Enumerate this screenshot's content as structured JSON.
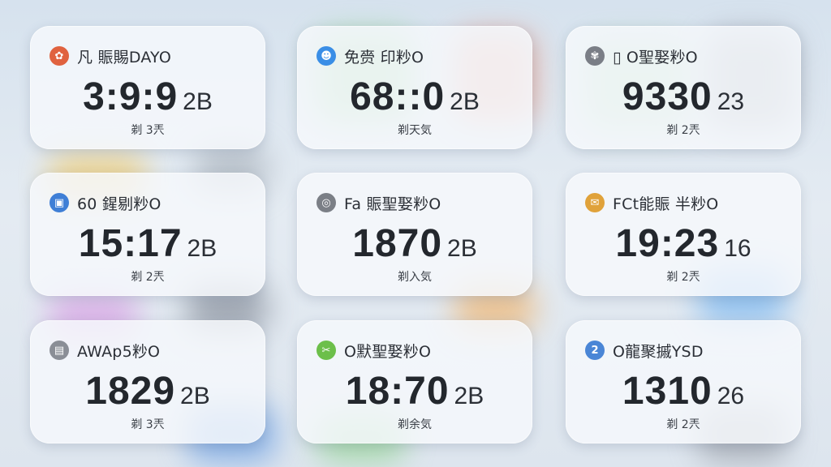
{
  "colors": {
    "background": "#dfe6ee",
    "card": "#f6f8fb",
    "text": "#23272d"
  },
  "cards": [
    {
      "title": "凡 賑賜DAYO",
      "time": "3:9:9",
      "unit": "2B",
      "sub": "剃 3兲",
      "icon": "gear-icon",
      "icon_color": "#e0623f",
      "icon_glyph": "✿"
    },
    {
      "title": "免赍 印粆O",
      "time": "68::0",
      "unit": "2B",
      "sub": "剃天気",
      "icon": "person-icon",
      "icon_color": "#3a8ee6",
      "icon_glyph": "☻"
    },
    {
      "title": "▯ O聖娶粆O",
      "time": "9330",
      "unit": "23",
      "sub": "剃 2兲",
      "icon": "flower-icon",
      "icon_color": "#7a7e86",
      "icon_glyph": "✾"
    },
    {
      "title": "60 鍟剔粆O",
      "time": "15:17",
      "unit": "2B",
      "sub": "剃 2兲",
      "icon": "card-icon",
      "icon_color": "#3f7fd6",
      "icon_glyph": "▣"
    },
    {
      "title": "Fa 賑聖娶粆O",
      "time": "1870",
      "unit": "2B",
      "sub": "剃入気",
      "icon": "compass-icon",
      "icon_color": "#7b7f86",
      "icon_glyph": "◎"
    },
    {
      "title": "FCt能賑 半粆O",
      "time": "19:23",
      "unit": "16",
      "sub": "剃 2兲",
      "icon": "chat-icon",
      "icon_color": "#e0a23a",
      "icon_glyph": "✉"
    },
    {
      "title": "AWAp5粆O",
      "time": "1829",
      "unit": "2B",
      "sub": "剃 3兲",
      "icon": "image-icon",
      "icon_color": "#8a8e96",
      "icon_glyph": "▤"
    },
    {
      "title": "O默聖娶粆O",
      "time": "18:70",
      "unit": "2B",
      "sub": "剃余気",
      "icon": "leaf-icon",
      "icon_color": "#6cbf4a",
      "icon_glyph": "✂"
    },
    {
      "title": "O龍聚摵YSD",
      "time": "1310",
      "unit": "26",
      "sub": "剃 2兲",
      "icon": "number-icon",
      "icon_color": "#4a86d6",
      "icon_glyph": "2"
    }
  ]
}
